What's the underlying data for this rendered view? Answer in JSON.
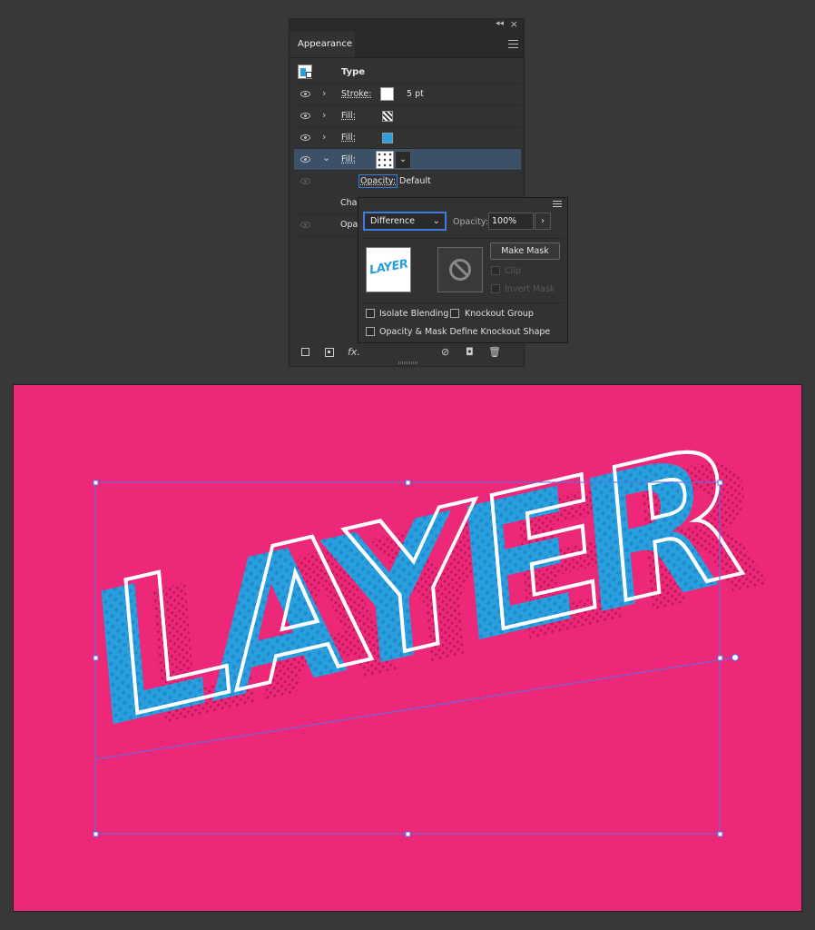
{
  "panel": {
    "tab_label": "Appearance",
    "type_row": {
      "label": "Type"
    },
    "rows": [
      {
        "label": "Stroke:",
        "value": "5 pt",
        "swatch": "white"
      },
      {
        "label": "Fill:",
        "swatch": "checker"
      },
      {
        "label": "Fill:",
        "swatch": "blue",
        "color": "#29a0dd"
      },
      {
        "label": "Fill:",
        "swatch": "dots",
        "selected": true
      }
    ],
    "opacity_row": {
      "label": "Opacity:",
      "value": "Default"
    },
    "char_row": {
      "label": "Char"
    },
    "opac_row": {
      "label": "Opac"
    }
  },
  "transparency": {
    "blend_mode": "Difference",
    "opacity_label": "Opacity:",
    "opacity_value": "100%",
    "thumb_text": "LAYER",
    "make_mask_label": "Make Mask",
    "clip_label": "Clip",
    "invert_mask_label": "Invert Mask",
    "isolate_blending_label": "Isolate Blending",
    "knockout_group_label": "Knockout Group",
    "knockout_shape_label": "Opacity & Mask Define Knockout Shape"
  },
  "canvas": {
    "text": "LAYER",
    "background": "#ed2878",
    "shadow_color": "#29a0dd",
    "selection_color": "#5b6ee8"
  },
  "icons": {
    "footer": [
      "new-stroke-icon",
      "new-fill-icon",
      "fx-icon",
      "clear-appearance-icon",
      "duplicate-item-icon",
      "delete-item-icon"
    ],
    "fx_glyph": "fx."
  }
}
